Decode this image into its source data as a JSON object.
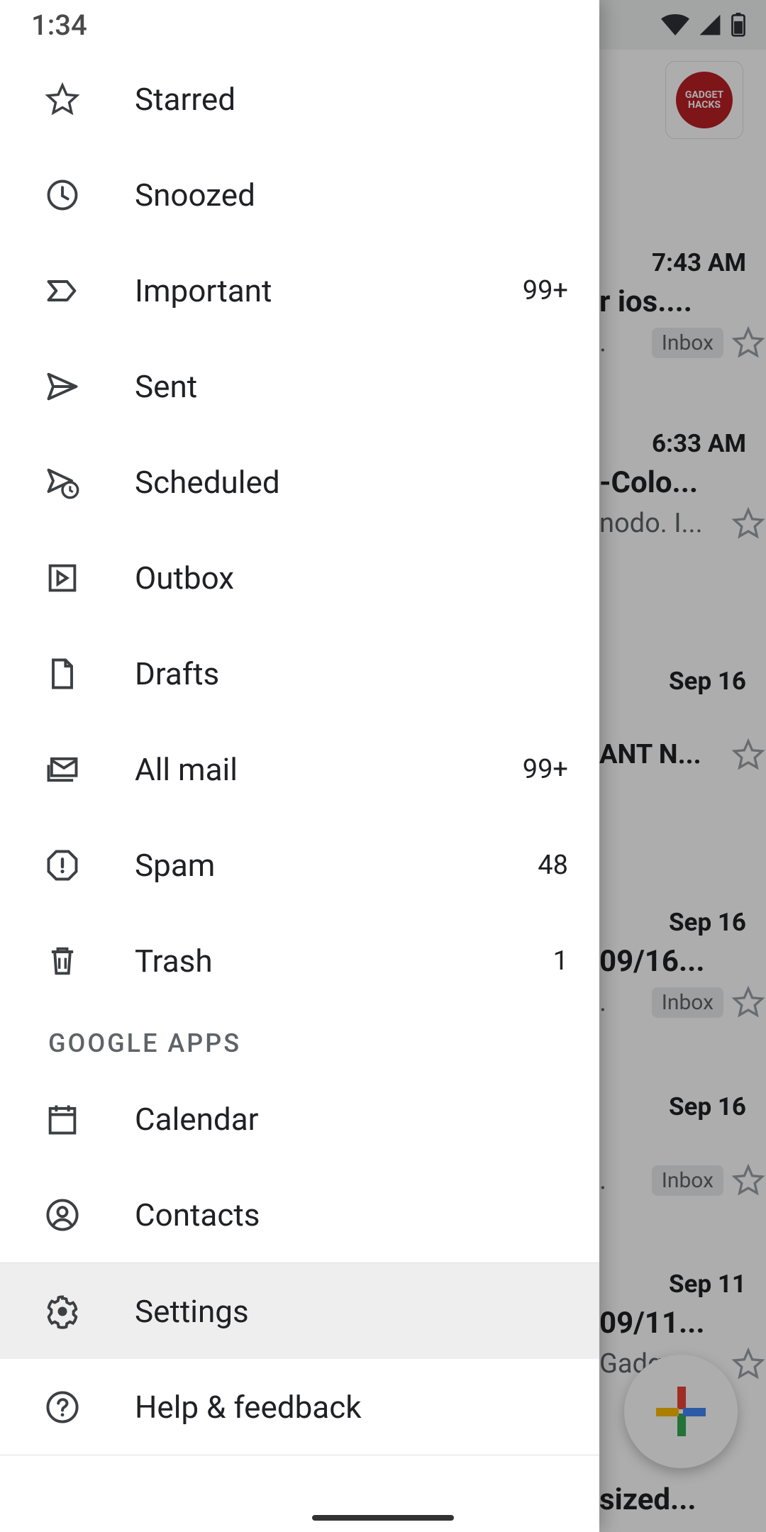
{
  "statusbar": {
    "time": "1:34"
  },
  "drawer": {
    "items": [
      {
        "key": "starred",
        "label": "Starred",
        "count": ""
      },
      {
        "key": "snoozed",
        "label": "Snoozed",
        "count": ""
      },
      {
        "key": "important",
        "label": "Important",
        "count": "99+"
      },
      {
        "key": "sent",
        "label": "Sent",
        "count": ""
      },
      {
        "key": "scheduled",
        "label": "Scheduled",
        "count": ""
      },
      {
        "key": "outbox",
        "label": "Outbox",
        "count": ""
      },
      {
        "key": "drafts",
        "label": "Drafts",
        "count": ""
      },
      {
        "key": "allmail",
        "label": "All mail",
        "count": "99+"
      },
      {
        "key": "spam",
        "label": "Spam",
        "count": "48"
      },
      {
        "key": "trash",
        "label": "Trash",
        "count": "1"
      }
    ],
    "section_header": "GOOGLE APPS",
    "apps": [
      {
        "key": "calendar",
        "label": "Calendar"
      },
      {
        "key": "contacts",
        "label": "Contacts"
      }
    ],
    "footer": [
      {
        "key": "settings",
        "label": "Settings",
        "selected": true
      },
      {
        "key": "help",
        "label": "Help & feedback"
      }
    ]
  },
  "inbox": {
    "avatar_text": "GADGET HACKS",
    "inbox_chip": "Inbox",
    "messages": [
      {
        "time": "7:43 AM",
        "subject": "r ios....",
        "snippet": ".",
        "chip": true
      },
      {
        "time": "6:33 AM",
        "subject": "-Colo...",
        "snippet": "nodo. I...",
        "chip": false
      },
      {
        "time": "Sep 16",
        "subject": "",
        "snippet": "ANT N...",
        "chip": false
      },
      {
        "time": "Sep 16",
        "subject": "09/16...",
        "snippet": ".",
        "chip": true
      },
      {
        "time": "Sep 16",
        "subject": "",
        "snippet": ".",
        "chip": true
      },
      {
        "time": "Sep 11",
        "subject": "09/11...",
        "snippet": "Gadge...",
        "chip": false
      },
      {
        "time": "",
        "subject": "sized...",
        "snippet": "",
        "chip": false
      }
    ]
  }
}
